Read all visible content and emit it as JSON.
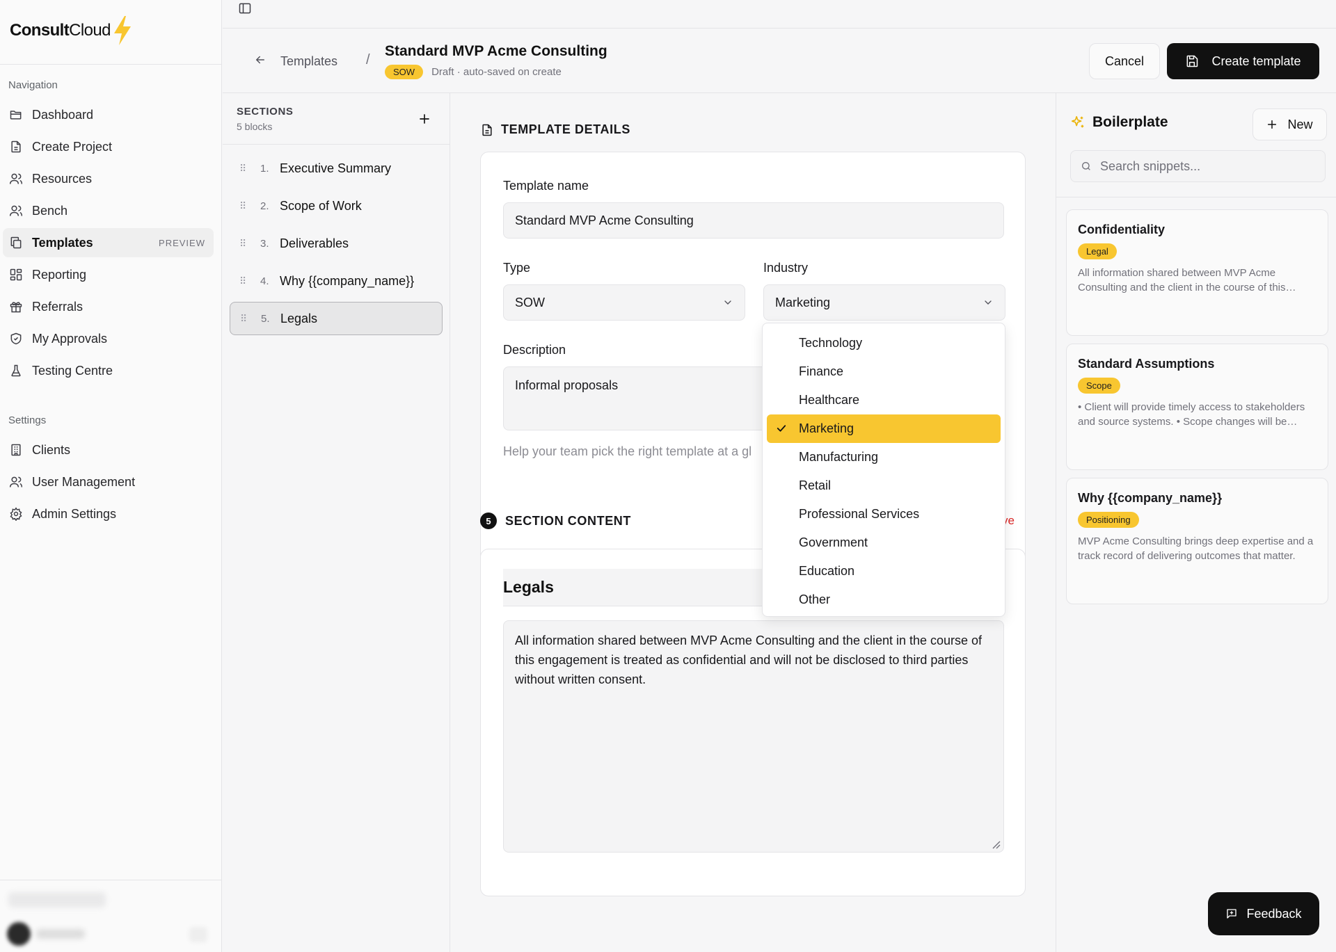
{
  "brand": {
    "name_bold": "Consult",
    "name_light": "Cloud",
    "accent": "#f8c630"
  },
  "sidebar": {
    "nav_heading": "Navigation",
    "nav_items": [
      {
        "label": "Dashboard",
        "icon": "folder-open-icon"
      },
      {
        "label": "Create Project",
        "icon": "file-text-icon"
      },
      {
        "label": "Resources",
        "icon": "users-icon"
      },
      {
        "label": "Bench",
        "icon": "users-icon"
      },
      {
        "label": "Templates",
        "icon": "copy-icon",
        "badge": "PREVIEW",
        "active": true
      },
      {
        "label": "Reporting",
        "icon": "grid-icon"
      },
      {
        "label": "Referrals",
        "icon": "gift-icon"
      },
      {
        "label": "My Approvals",
        "icon": "shield-check-icon"
      },
      {
        "label": "Testing Centre",
        "icon": "flask-icon"
      }
    ],
    "settings_heading": "Settings",
    "settings_items": [
      {
        "label": "Clients",
        "icon": "building-icon"
      },
      {
        "label": "User Management",
        "icon": "users-icon"
      },
      {
        "label": "Admin Settings",
        "icon": "gear-icon"
      }
    ]
  },
  "header": {
    "back_label": "Templates",
    "separator": "/",
    "title": "Standard MVP Acme Consulting",
    "type_pill": "SOW",
    "status_text": "Draft · auto-saved on create",
    "cancel_label": "Cancel",
    "create_label": "Create template"
  },
  "sections": {
    "title": "SECTIONS",
    "count": "5 blocks",
    "items": [
      {
        "num": "1.",
        "label": "Executive Summary"
      },
      {
        "num": "2.",
        "label": "Scope of Work"
      },
      {
        "num": "3.",
        "label": "Deliverables"
      },
      {
        "num": "4.",
        "label": "Why {{company_name}}"
      },
      {
        "num": "5.",
        "label": "Legals",
        "active": true
      }
    ]
  },
  "details": {
    "heading": "TEMPLATE DETAILS",
    "name_label": "Template name",
    "name_value": "Standard MVP Acme Consulting",
    "type_label": "Type",
    "type_value": "SOW",
    "industry_label": "Industry",
    "industry_value": "Marketing",
    "description_label": "Description",
    "description_value": "Informal proposals",
    "helper_text": "Help your team pick the right template at a gl"
  },
  "industry_dropdown": {
    "options": [
      "Technology",
      "Finance",
      "Healthcare",
      "Marketing",
      "Manufacturing",
      "Retail",
      "Professional Services",
      "Government",
      "Education",
      "Other"
    ],
    "selected": "Marketing"
  },
  "section_content": {
    "step": "5",
    "heading": "SECTION CONTENT",
    "remove_label": "ve",
    "section_title": "Legals",
    "body": "All information shared between MVP Acme Consulting and the client in the course of this engagement is treated as confidential and will not be disclosed to third parties without written consent."
  },
  "boilerplate": {
    "title": "Boilerplate",
    "new_label": "New",
    "search_placeholder": "Search snippets...",
    "snippets": [
      {
        "title": "Confidentiality",
        "tag": "Legal",
        "body": "All information shared between MVP Acme Consulting and the client in the course of this engagement is treated as confidential."
      },
      {
        "title": "Standard Assumptions",
        "tag": "Scope",
        "body": "• Client will provide timely access to stakeholders and source systems. • Scope changes will be handled through change requests."
      },
      {
        "title": "Why {{company_name}}",
        "tag": "Positioning",
        "body": "MVP Acme Consulting brings deep expertise and a track record of delivering outcomes that matter."
      }
    ]
  },
  "feedback_label": "Feedback"
}
